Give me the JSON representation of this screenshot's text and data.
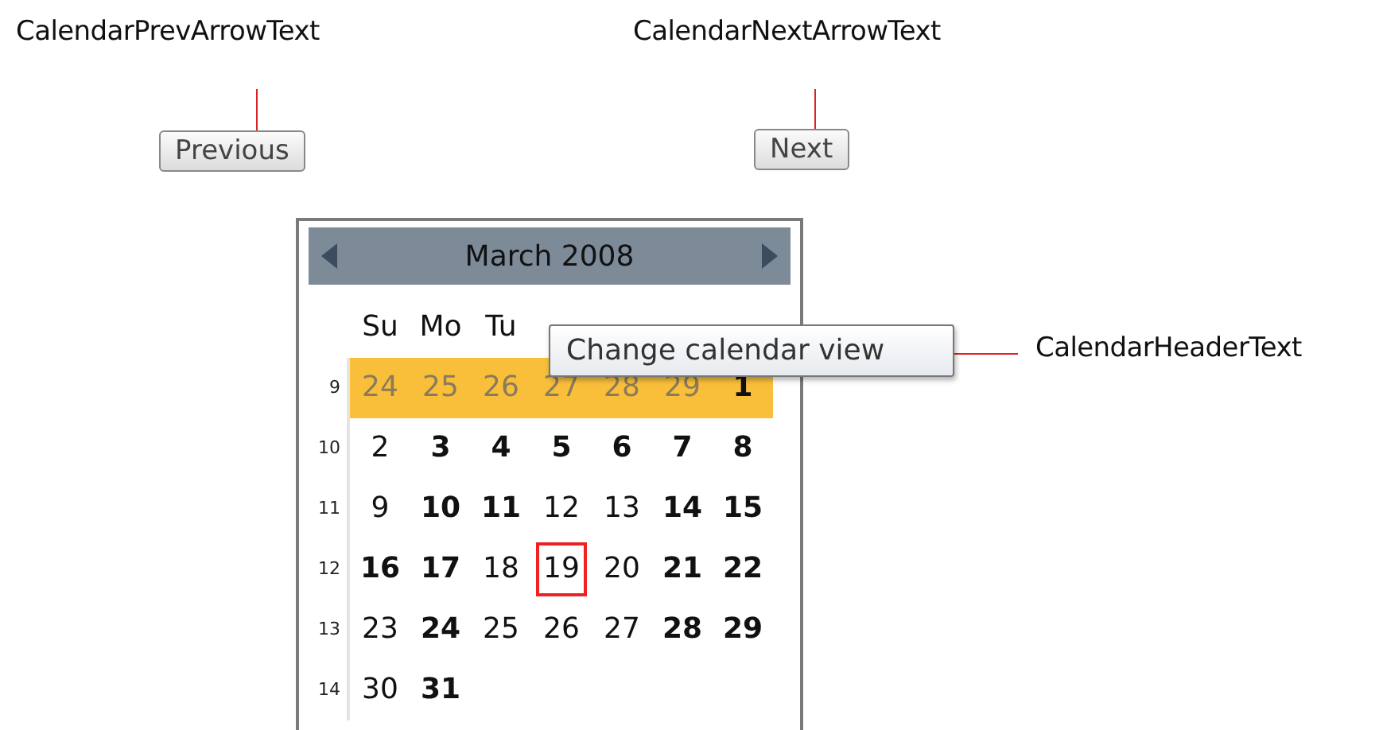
{
  "annotations": [
    {
      "label": "CalendarPrevArrowText"
    },
    {
      "label": "CalendarNextArrowText"
    },
    {
      "label": "CalendarHeaderText"
    }
  ],
  "buttons": [
    {
      "label": "Previous",
      "kind": "prev"
    },
    {
      "label": "Next",
      "kind": "next"
    }
  ],
  "calendar": {
    "title": "March 2008",
    "weekdays": [
      "Su",
      "Mo",
      "Tu"
    ],
    "weeks": [
      {
        "number": "9",
        "selected": true,
        "days": [
          {
            "day": "24",
            "bold": false,
            "other_month": true,
            "today": false
          },
          {
            "day": "25",
            "bold": false,
            "other_month": true,
            "today": false
          },
          {
            "day": "26",
            "bold": false,
            "other_month": true,
            "today": false
          },
          {
            "day": "27",
            "bold": false,
            "other_month": true,
            "today": false
          },
          {
            "day": "28",
            "bold": false,
            "other_month": true,
            "today": false
          },
          {
            "day": "29",
            "bold": false,
            "other_month": true,
            "today": false
          },
          {
            "day": "1",
            "bold": true,
            "other_month": false,
            "today": false
          }
        ]
      },
      {
        "number": "10",
        "selected": false,
        "days": [
          {
            "day": "2",
            "bold": false,
            "other_month": false,
            "today": false
          },
          {
            "day": "3",
            "bold": true,
            "other_month": false,
            "today": false
          },
          {
            "day": "4",
            "bold": true,
            "other_month": false,
            "today": false
          },
          {
            "day": "5",
            "bold": true,
            "other_month": false,
            "today": false
          },
          {
            "day": "6",
            "bold": true,
            "other_month": false,
            "today": false
          },
          {
            "day": "7",
            "bold": true,
            "other_month": false,
            "today": false
          },
          {
            "day": "8",
            "bold": true,
            "other_month": false,
            "today": false
          }
        ]
      },
      {
        "number": "11",
        "selected": false,
        "days": [
          {
            "day": "9",
            "bold": false,
            "other_month": false,
            "today": false
          },
          {
            "day": "10",
            "bold": true,
            "other_month": false,
            "today": false
          },
          {
            "day": "11",
            "bold": true,
            "other_month": false,
            "today": false
          },
          {
            "day": "12",
            "bold": false,
            "other_month": false,
            "today": false
          },
          {
            "day": "13",
            "bold": false,
            "other_month": false,
            "today": false
          },
          {
            "day": "14",
            "bold": true,
            "other_month": false,
            "today": false
          },
          {
            "day": "15",
            "bold": true,
            "other_month": false,
            "today": false
          }
        ]
      },
      {
        "number": "12",
        "selected": false,
        "days": [
          {
            "day": "16",
            "bold": true,
            "other_month": false,
            "today": false
          },
          {
            "day": "17",
            "bold": true,
            "other_month": false,
            "today": false
          },
          {
            "day": "18",
            "bold": false,
            "other_month": false,
            "today": false
          },
          {
            "day": "19",
            "bold": false,
            "other_month": false,
            "today": true
          },
          {
            "day": "20",
            "bold": false,
            "other_month": false,
            "today": false
          },
          {
            "day": "21",
            "bold": true,
            "other_month": false,
            "today": false
          },
          {
            "day": "22",
            "bold": true,
            "other_month": false,
            "today": false
          }
        ]
      },
      {
        "number": "13",
        "selected": false,
        "days": [
          {
            "day": "23",
            "bold": false,
            "other_month": false,
            "today": false
          },
          {
            "day": "24",
            "bold": true,
            "other_month": false,
            "today": false
          },
          {
            "day": "25",
            "bold": false,
            "other_month": false,
            "today": false
          },
          {
            "day": "26",
            "bold": false,
            "other_month": false,
            "today": false
          },
          {
            "day": "27",
            "bold": false,
            "other_month": false,
            "today": false
          },
          {
            "day": "28",
            "bold": true,
            "other_month": false,
            "today": false
          },
          {
            "day": "29",
            "bold": true,
            "other_month": false,
            "today": false
          }
        ]
      },
      {
        "number": "14",
        "selected": false,
        "days": [
          {
            "day": "30",
            "bold": false,
            "other_month": false,
            "today": false
          },
          {
            "day": "31",
            "bold": true,
            "other_month": false,
            "today": false
          }
        ]
      }
    ]
  },
  "tooltip": {
    "text": "Change calendar view"
  }
}
